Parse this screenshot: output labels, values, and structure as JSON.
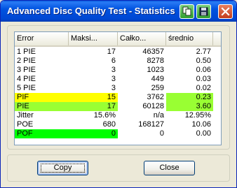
{
  "window": {
    "title": "Advanced Disc Quality Test - Statistics"
  },
  "colors": {
    "yellow": "#ffff00",
    "lime": "#99ff33",
    "green": "#00ff00"
  },
  "icons": {
    "copy": "copy-icon",
    "save": "save-icon",
    "close": "close-icon"
  },
  "table": {
    "headers": [
      "Error",
      "Maksi...",
      "Całko...",
      "średnio"
    ],
    "rows": [
      {
        "cells": [
          "1 PIE",
          "17",
          "46357",
          "2.77"
        ],
        "highlight": [
          "",
          "",
          "",
          ""
        ]
      },
      {
        "cells": [
          "2 PIE",
          "6",
          "8278",
          "0.50"
        ],
        "highlight": [
          "",
          "",
          "",
          ""
        ]
      },
      {
        "cells": [
          "3 PIE",
          "3",
          "1023",
          "0.06"
        ],
        "highlight": [
          "",
          "",
          "",
          ""
        ]
      },
      {
        "cells": [
          "4 PIE",
          "3",
          "449",
          "0.03"
        ],
        "highlight": [
          "",
          "",
          "",
          ""
        ]
      },
      {
        "cells": [
          "5 PIE",
          "3",
          "259",
          "0.02"
        ],
        "highlight": [
          "",
          "",
          "",
          ""
        ]
      },
      {
        "cells": [
          "PIF",
          "15",
          "3762",
          "0.23"
        ],
        "highlight": [
          "yellow",
          "yellow",
          "",
          "lime"
        ]
      },
      {
        "cells": [
          "PIE",
          "17",
          "60128",
          "3.60"
        ],
        "highlight": [
          "lime",
          "lime",
          "",
          "lime"
        ]
      },
      {
        "cells": [
          "Jitter",
          "15.6%",
          "n/a",
          "12.95%"
        ],
        "highlight": [
          "",
          "",
          "",
          ""
        ]
      },
      {
        "cells": [
          "POE",
          "680",
          "168127",
          "10.06"
        ],
        "highlight": [
          "",
          "",
          "",
          ""
        ]
      },
      {
        "cells": [
          "POF",
          "0",
          "0",
          "0.00"
        ],
        "highlight": [
          "green",
          "green",
          "",
          ""
        ]
      }
    ]
  },
  "buttons": {
    "copy_label": "Copy",
    "close_label": "Close"
  }
}
